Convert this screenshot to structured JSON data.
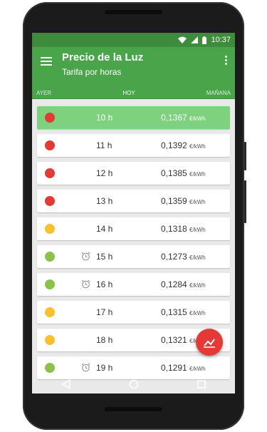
{
  "status": {
    "time": "10:37"
  },
  "app": {
    "title": "Precio de la Luz",
    "subtitle": "Tarifa por horas"
  },
  "tabs": {
    "items": [
      "AYER",
      "HOY",
      "MAÑANA"
    ],
    "active": "HOY"
  },
  "colors": {
    "red": "#e53935",
    "orange": "#fbc02d",
    "green": "#8bc34a",
    "current_row": "#7ed27e",
    "primary": "#4aa54a"
  },
  "rows": [
    {
      "hour": "10 h",
      "price": "0,1367",
      "unit": "€/kWh",
      "level": "red",
      "alarm": false,
      "current": true
    },
    {
      "hour": "11 h",
      "price": "0,1392",
      "unit": "€/kWh",
      "level": "red",
      "alarm": false,
      "current": false
    },
    {
      "hour": "12 h",
      "price": "0,1385",
      "unit": "€/kWh",
      "level": "red",
      "alarm": false,
      "current": false
    },
    {
      "hour": "13 h",
      "price": "0,1359",
      "unit": "€/kWh",
      "level": "red",
      "alarm": false,
      "current": false
    },
    {
      "hour": "14 h",
      "price": "0,1318",
      "unit": "€/kWh",
      "level": "orange",
      "alarm": false,
      "current": false
    },
    {
      "hour": "15 h",
      "price": "0,1273",
      "unit": "€/kWh",
      "level": "green",
      "alarm": true,
      "current": false
    },
    {
      "hour": "16 h",
      "price": "0,1284",
      "unit": "€/kWh",
      "level": "green",
      "alarm": true,
      "current": false
    },
    {
      "hour": "17 h",
      "price": "0,1315",
      "unit": "€/kWh",
      "level": "orange",
      "alarm": false,
      "current": false
    },
    {
      "hour": "18 h",
      "price": "0,1321",
      "unit": "€/kWh",
      "level": "orange",
      "alarm": false,
      "current": false
    },
    {
      "hour": "19 h",
      "price": "0,1291",
      "unit": "€/kWh",
      "level": "green",
      "alarm": true,
      "current": false
    }
  ]
}
